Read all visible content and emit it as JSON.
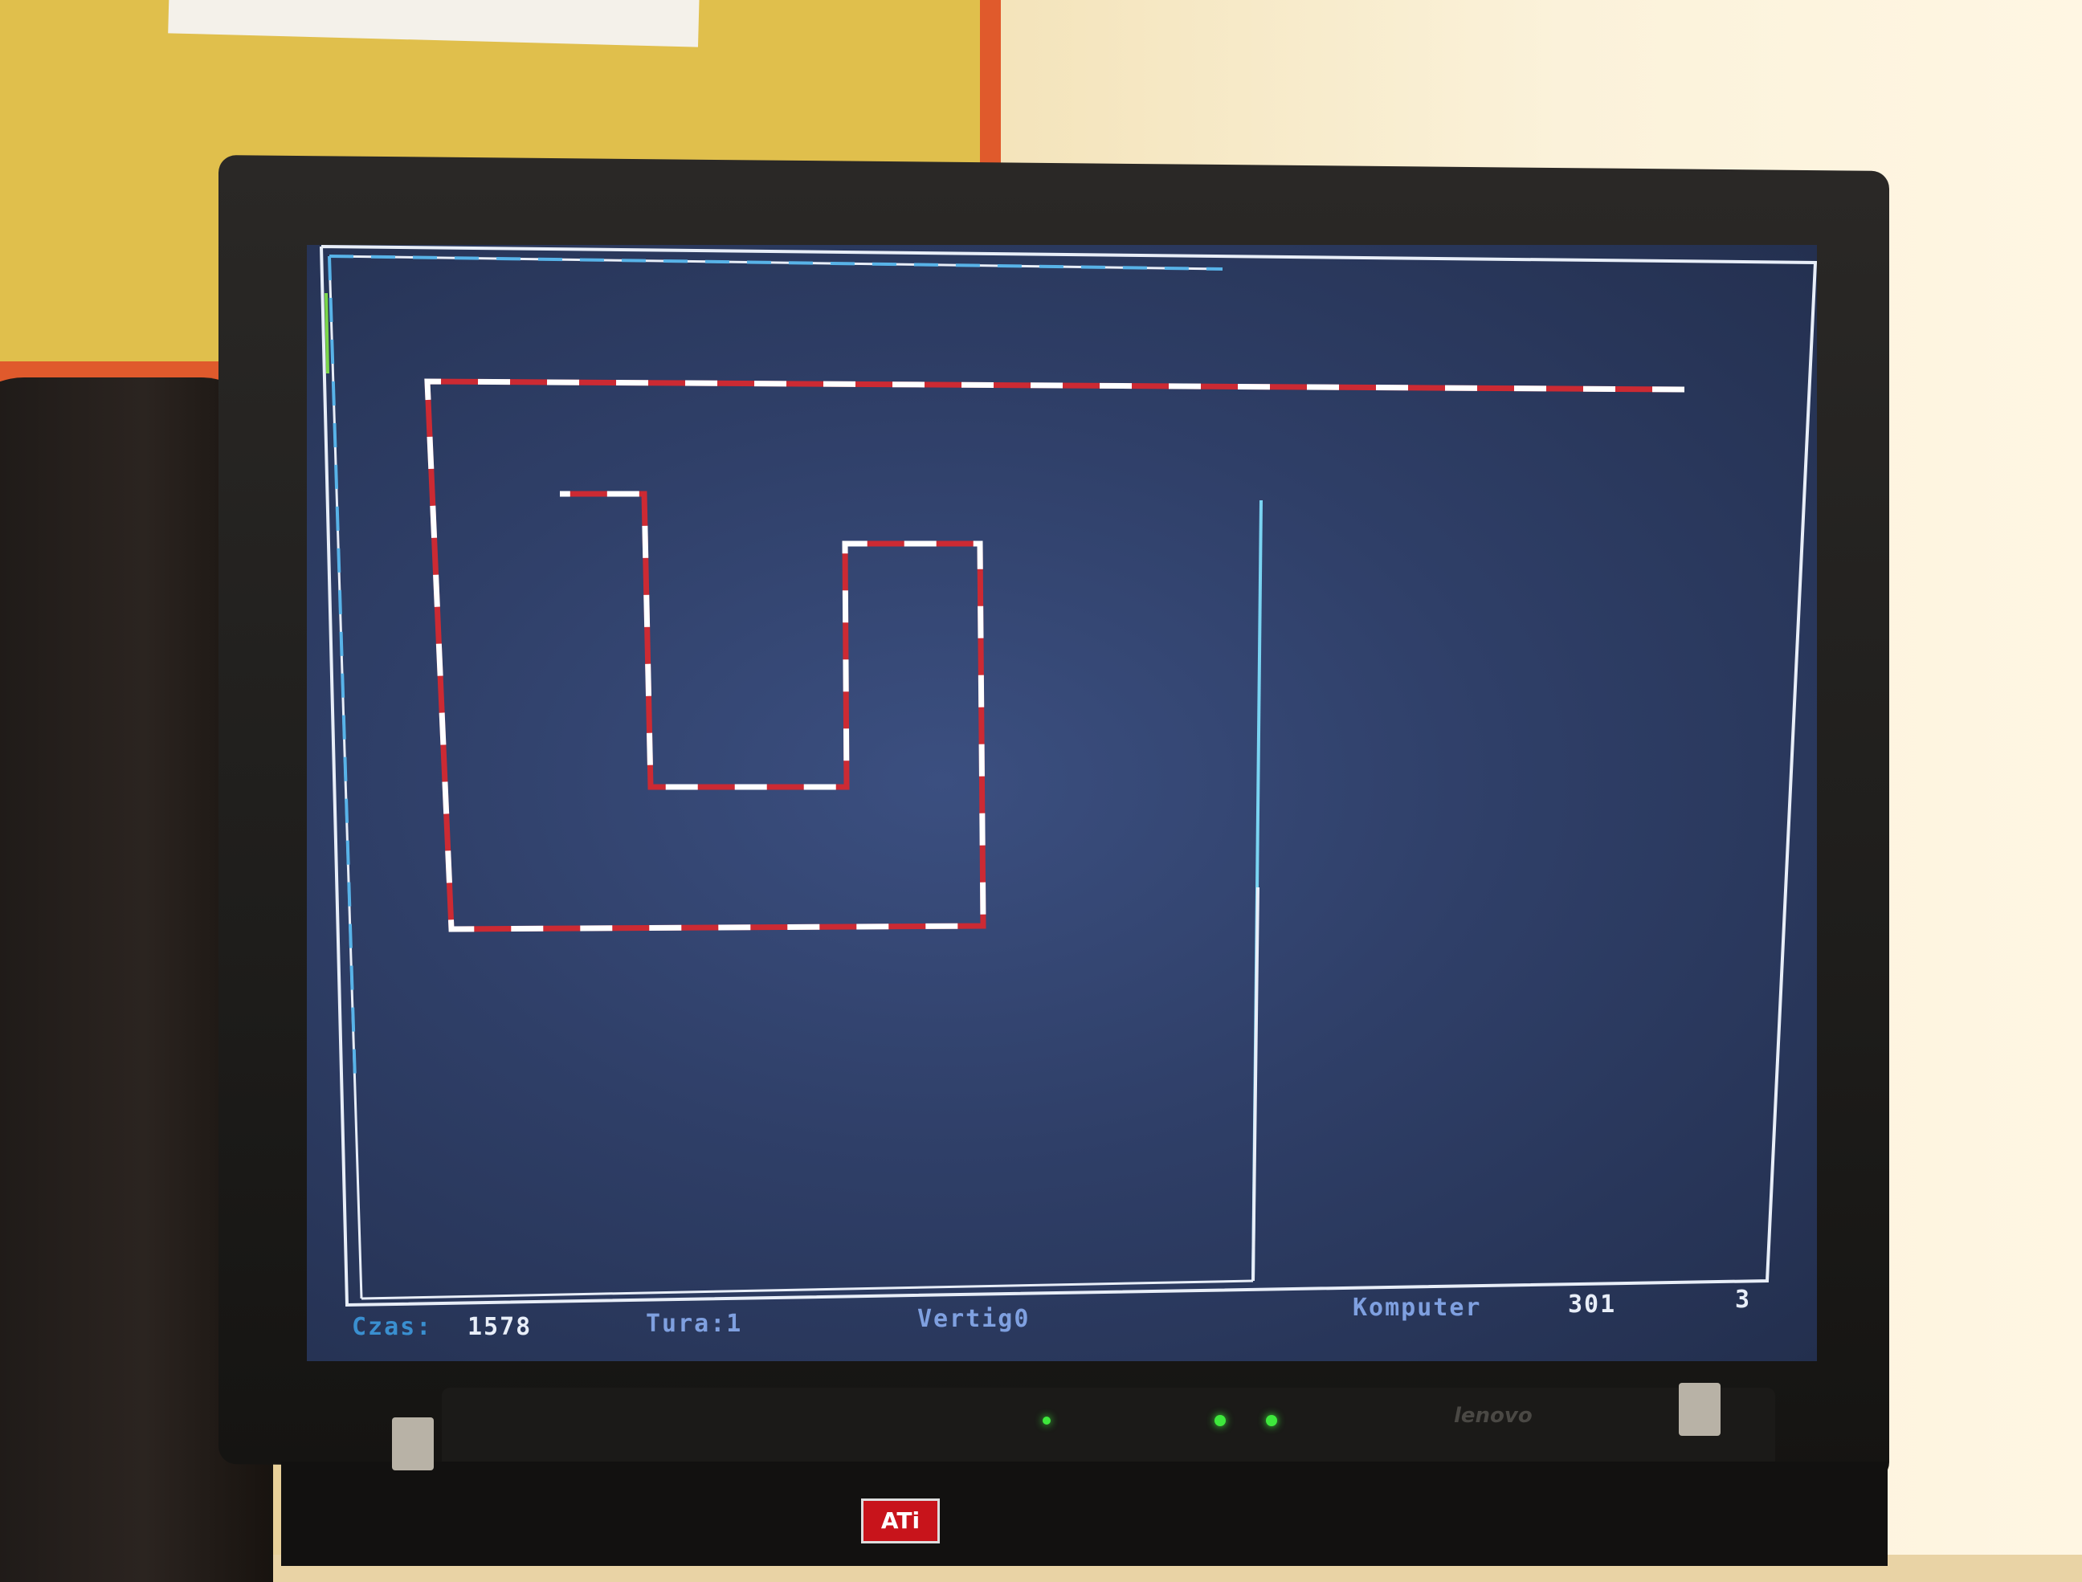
{
  "game": {
    "status_bar": {
      "time_label": "Czas:",
      "time_value": "1578",
      "round_label": "Tura:1",
      "player_name": "Vertig0",
      "computer_label": "Komputer",
      "computer_score": "301",
      "level_number": "3"
    },
    "colors": {
      "screen_background": "#2f3f68",
      "frame_line": "#e8eef8",
      "player_trail_dash_a": "#cc2a33",
      "player_trail_dash_b": "#ffffff",
      "opponent_trail": "#7ad4f2",
      "status_time": "#3a8fd0",
      "status_round": "#7fa0e0",
      "status_player": "#7fa0e0",
      "status_computer": "#7fa0e0",
      "status_score": "#e8eef8"
    }
  },
  "laptop": {
    "brand_logo": "lenovo",
    "sticker_logo": "ATi"
  }
}
